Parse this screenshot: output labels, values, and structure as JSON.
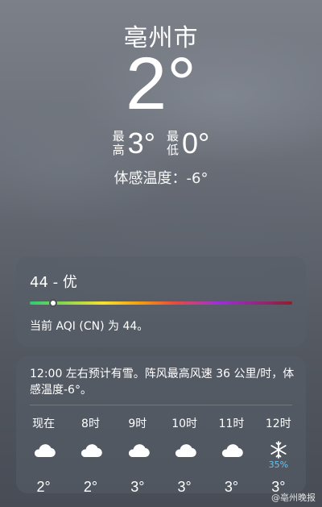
{
  "header": {
    "city": "亳州市",
    "temperature": "2°",
    "high_label": "最高",
    "high_value": "3°",
    "low_label": "最低",
    "low_value": "0°",
    "feels_like": "体感温度：-6°"
  },
  "aqi": {
    "title": "44 - 优",
    "indicator_fraction": 0.09,
    "description": "当前 AQI (CN) 为 44。"
  },
  "hourly": {
    "summary": "12:00 左右预计有雪。阵风最高风速 36 公里/时，体感温度-6°。",
    "items": [
      {
        "time": "现在",
        "icon": "cloud-icon",
        "prob": "",
        "temp": "2°"
      },
      {
        "time": "8时",
        "icon": "cloud-icon",
        "prob": "",
        "temp": "2°"
      },
      {
        "time": "9时",
        "icon": "cloud-icon",
        "prob": "",
        "temp": "3°"
      },
      {
        "time": "10时",
        "icon": "cloud-icon",
        "prob": "",
        "temp": "3°"
      },
      {
        "time": "11时",
        "icon": "cloud-icon",
        "prob": "",
        "temp": "3°"
      },
      {
        "time": "12时",
        "icon": "snowflake-icon",
        "prob": "35%",
        "temp": "3°"
      }
    ]
  },
  "watermark": "@亳州晚报",
  "colors": {
    "aqi_indicator": "#ffffff",
    "precip_prob": "#69c2f0"
  }
}
